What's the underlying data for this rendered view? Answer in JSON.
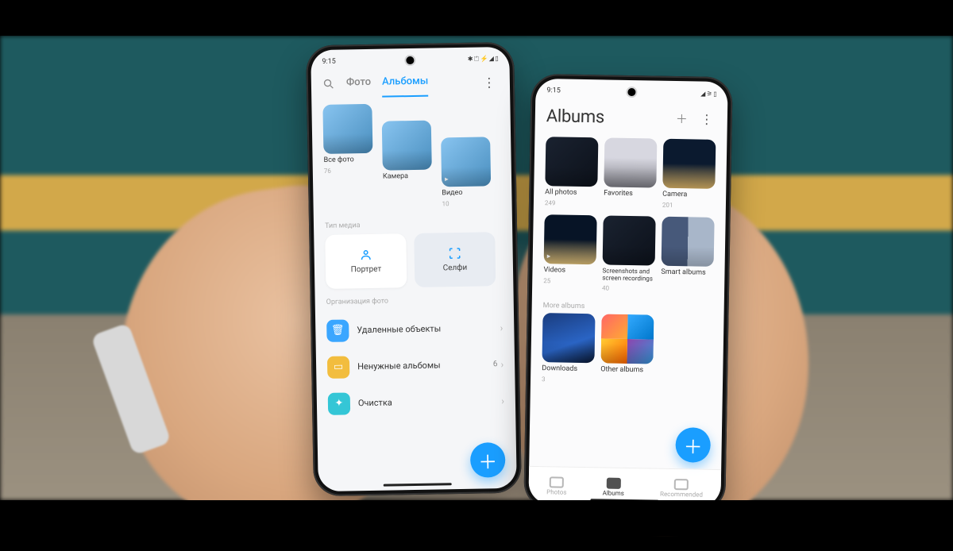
{
  "left_phone": {
    "status_time": "9:15",
    "status_icons": "✱ ⏍ ⚡ ◢ ▯",
    "tabs": {
      "photos": "Фото",
      "albums": "Альбомы"
    },
    "albums_top": [
      {
        "label": "Все фото",
        "count": "76"
      },
      {
        "label": "Камера",
        "count": ""
      },
      {
        "label": "Видео",
        "count": "10",
        "video": true
      }
    ],
    "media_type_section": "Тип медиа",
    "media_types": {
      "portrait": "Портрет",
      "selfie": "Селфи"
    },
    "org_section": "Организация фото",
    "org_items": {
      "deleted": "Удаленные объекты",
      "unneeded": {
        "label": "Ненужные альбомы",
        "count": "6"
      },
      "cleanup": "Очистка"
    }
  },
  "right_phone": {
    "status_time": "9:15",
    "status_icons": "◢ ⚞ ▯",
    "title": "Albums",
    "albums": [
      {
        "label": "All photos",
        "count": "249"
      },
      {
        "label": "Favorites",
        "count": ""
      },
      {
        "label": "Camera",
        "count": "201"
      },
      {
        "label": "Videos",
        "count": "25",
        "video": true
      },
      {
        "label": "Screenshots and screen recordings",
        "count": "40"
      },
      {
        "label": "Smart albums",
        "count": ""
      }
    ],
    "more_section": "More albums",
    "more_albums": [
      {
        "label": "Downloads",
        "count": "3"
      },
      {
        "label": "Other albums",
        "count": ""
      }
    ],
    "nav": {
      "photos": "Photos",
      "albums": "Albums",
      "recommended": "Recommended"
    }
  }
}
